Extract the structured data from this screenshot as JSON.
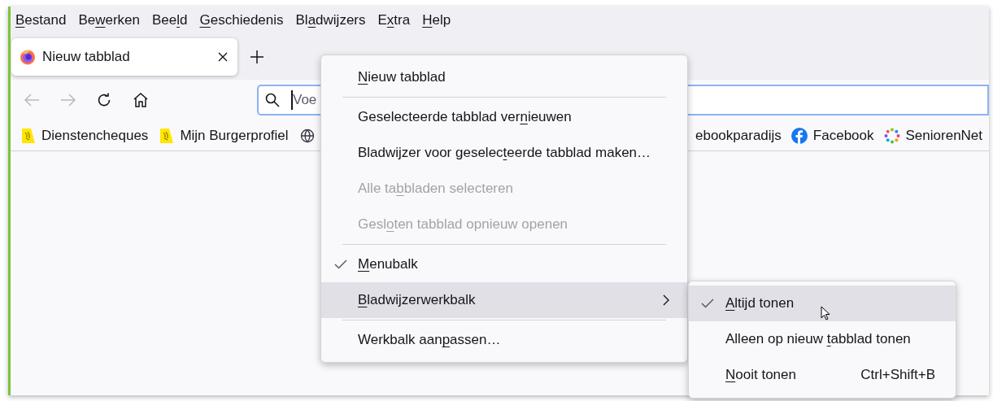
{
  "menubar": [
    {
      "key": "B",
      "after": "estand"
    },
    {
      "before": "Be",
      "key": "w",
      "after": "erken"
    },
    {
      "before": "Bee",
      "key": "l",
      "after": "d"
    },
    {
      "key": "G",
      "after": "eschiedenis"
    },
    {
      "before": "Bl",
      "key": "a",
      "after": "dwijzers"
    },
    {
      "before": "E",
      "key": "x",
      "after": "tra"
    },
    {
      "key": "H",
      "after": "elp"
    }
  ],
  "tabs": [
    {
      "title": "Nieuw tabblad",
      "selected": true
    }
  ],
  "navigation": {
    "back_disabled": true,
    "forward_disabled": true
  },
  "address_bar": {
    "placeholder": "Voe",
    "focused": true
  },
  "bookmarks_left": [
    {
      "title": "Dienstencheques",
      "kind": "flag"
    },
    {
      "title": "Mijn Burgerprofiel",
      "kind": "flag"
    },
    {
      "kind": "globe"
    }
  ],
  "bookmarks_right": [
    {
      "title": "ebookparadijs",
      "kind": "plain"
    },
    {
      "title": "Facebook",
      "kind": "facebook"
    },
    {
      "title": "SeniorenNet",
      "kind": "ring"
    }
  ],
  "context_menu": [
    {
      "kind": "item",
      "key": "N",
      "after": "ieuw tabblad",
      "checked": false,
      "disabled": false,
      "selected": false
    },
    {
      "kind": "separator"
    },
    {
      "kind": "item",
      "pre": "Geselecteerde tabblad ver",
      "key": "n",
      "after": "ieuwen",
      "checked": false,
      "disabled": false,
      "selected": false
    },
    {
      "kind": "item",
      "pre": "Bladwijzer voor geselec",
      "key": "t",
      "after": "eerde tabblad maken…",
      "checked": false,
      "disabled": false,
      "selected": false
    },
    {
      "kind": "item",
      "pre": "Alle ta",
      "key": "b",
      "after": "bladen selecteren",
      "checked": false,
      "disabled": true,
      "selected": false
    },
    {
      "kind": "item",
      "pre": "Gesl",
      "key": "o",
      "after": "ten tabblad opnieuw openen",
      "checked": false,
      "disabled": true,
      "selected": false
    },
    {
      "kind": "separator"
    },
    {
      "kind": "item",
      "key": "M",
      "after": "enubalk",
      "checked": true,
      "disabled": false,
      "selected": false
    },
    {
      "kind": "submenu",
      "key": "B",
      "after": "ladwijzerwerkbalk",
      "checked": false,
      "disabled": false,
      "selected": true
    },
    {
      "kind": "separator"
    },
    {
      "kind": "item",
      "pre": "Werkbalk aan",
      "key": "p",
      "after": "assen…",
      "checked": false,
      "disabled": false,
      "selected": false
    }
  ],
  "submenu": [
    {
      "key": "A",
      "after": "ltijd tonen",
      "checked": true,
      "selected": true
    },
    {
      "pre": "Alleen op nieuw ",
      "key": "t",
      "after": "abblad tonen",
      "checked": false,
      "selected": false
    },
    {
      "key": "N",
      "after": "ooit tonen",
      "shortcut": "Ctrl+Shift+B",
      "checked": false,
      "selected": false
    }
  ]
}
